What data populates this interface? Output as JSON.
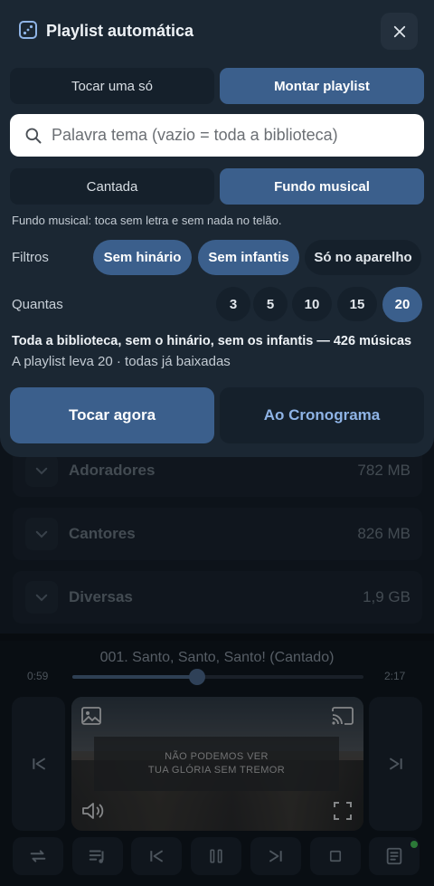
{
  "header": {
    "title": "Playlist automática"
  },
  "mode_tabs": [
    {
      "label": "Tocar uma só",
      "active": false
    },
    {
      "label": "Montar playlist",
      "active": true
    }
  ],
  "search": {
    "placeholder": "Palavra tema (vazio = toda a biblioteca)",
    "value": ""
  },
  "type_tabs": [
    {
      "label": "Cantada",
      "active": false
    },
    {
      "label": "Fundo musical",
      "active": true
    }
  ],
  "type_hint": "Fundo musical: toca sem letra e sem nada no telão.",
  "filters": {
    "label": "Filtros",
    "options": [
      {
        "label": "Sem hinário",
        "active": true
      },
      {
        "label": "Sem infantis",
        "active": true
      },
      {
        "label": "Só no aparelho",
        "active": false
      }
    ]
  },
  "count": {
    "label": "Quantas",
    "options": [
      "3",
      "5",
      "10",
      "15",
      "20"
    ],
    "selected": "20"
  },
  "summary": {
    "line1": "Toda a biblioteca, sem o hinário, sem os infantis — 426 músicas",
    "line2": "A playlist leva 20 · todas já baixadas"
  },
  "actions": {
    "play_now": "Tocar agora",
    "to_schedule": "Ao Cronograma"
  },
  "library": [
    {
      "name": "Adoradores",
      "size": "782 MB"
    },
    {
      "name": "Cantores",
      "size": "826 MB"
    },
    {
      "name": "Diversas",
      "size": "1,9 GB"
    }
  ],
  "player": {
    "now_playing": "001. Santo, Santo, Santo! (Cantado)",
    "elapsed": "0:59",
    "duration": "2:17",
    "progress": 0.43,
    "lyrics": [
      "NÃO PODEMOS VER",
      "TUA GLÓRIA SEM TREMOR"
    ]
  },
  "colors": {
    "accent": "#3b5f8c",
    "panel": "#1b2733",
    "status_dot": "#46c35a"
  }
}
